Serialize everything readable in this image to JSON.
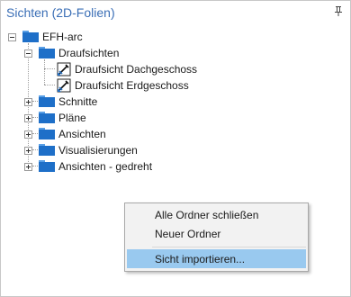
{
  "panel": {
    "title": "Sichten (2D-Folien)",
    "pin_icon": "pin-icon"
  },
  "tree": {
    "root": {
      "label": "EFH-arc",
      "expanded": true
    },
    "groups": [
      {
        "label": "Draufsichten",
        "expanded": true,
        "children": [
          {
            "label": "Draufsicht Dachgeschoss"
          },
          {
            "label": "Draufsicht Erdgeschoss"
          }
        ]
      },
      {
        "label": "Schnitte",
        "expanded": false
      },
      {
        "label": "Pläne",
        "expanded": false
      },
      {
        "label": "Ansichten",
        "expanded": false
      },
      {
        "label": "Visualisierungen",
        "expanded": false
      },
      {
        "label": "Ansichten - gedreht",
        "expanded": false
      }
    ]
  },
  "context_menu": {
    "items": [
      {
        "label": "Alle Ordner schließen"
      },
      {
        "label": "Neuer Ordner"
      },
      {
        "label": "Sicht importieren...",
        "highlighted": true
      }
    ]
  },
  "colors": {
    "title": "#3b6fb6",
    "folder": "#1e6fc8",
    "folder_tab": "#5aa0e6",
    "menu_highlight": "#99c9ef"
  }
}
